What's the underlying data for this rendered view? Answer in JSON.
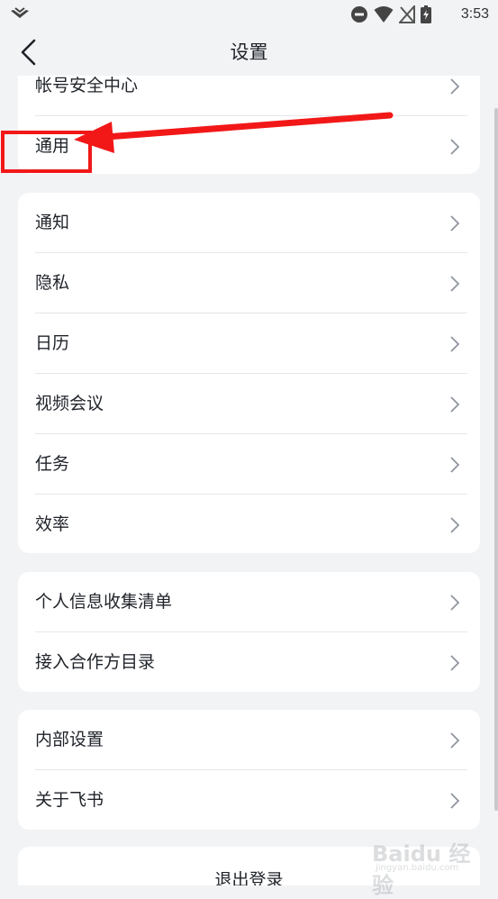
{
  "status_bar": {
    "time": "3:53",
    "icons": [
      "do-not-disturb-icon",
      "wifi-icon",
      "no-signal-icon",
      "battery-charging-icon"
    ]
  },
  "nav": {
    "title": "设置",
    "back_icon": "chevron-left-icon"
  },
  "groups": [
    {
      "items": [
        {
          "label": "帐号安全中心"
        },
        {
          "label": "通用"
        }
      ]
    },
    {
      "items": [
        {
          "label": "通知"
        },
        {
          "label": "隐私"
        },
        {
          "label": "日历"
        },
        {
          "label": "视频会议"
        },
        {
          "label": "任务"
        },
        {
          "label": "效率"
        }
      ]
    },
    {
      "items": [
        {
          "label": "个人信息收集清单"
        },
        {
          "label": "接入合作方目录"
        }
      ]
    },
    {
      "items": [
        {
          "label": "内部设置"
        },
        {
          "label": "关于飞书"
        }
      ]
    }
  ],
  "logout_label": "退出登录",
  "annotation": {
    "color": "#f21818",
    "highlight_target": "通用"
  },
  "watermark": {
    "text": "Baidu 经验",
    "sub": "jingyan.baidu.com"
  }
}
